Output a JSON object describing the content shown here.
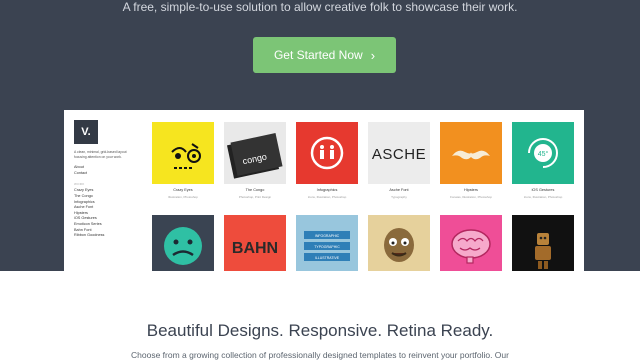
{
  "hero": {
    "tagline": "A free, simple-to-use solution to allow creative folk to showcase their work.",
    "cta_label": "Get Started Now",
    "cta_icon": "chevron-right-icon",
    "colors": {
      "background": "#3b4351",
      "cta": "#7cc576"
    }
  },
  "preview": {
    "logo": "V.",
    "description": "A clean, minimal, grid-based layout focusing attention on your work.",
    "links": [
      "About",
      "Contact"
    ],
    "work_heading": "WORK",
    "work_items": [
      "Crazy Eyes",
      "The Congo",
      "Infographics",
      "Asche Font",
      "Hipsters",
      "iOS Gestures",
      "Emoticon Series",
      "Bahn Font",
      "Ribbon Goodness"
    ],
    "tiles": [
      {
        "title": "Crazy Eyes",
        "tags": "Illustration, Photoshop",
        "bg": "#f6e51f"
      },
      {
        "title": "The Congo",
        "tags": "Photoshop, Print Design",
        "bg": "#e9e9e9"
      },
      {
        "title": "Infographics",
        "tags": "Icons, Illustration, Photoshop",
        "bg": "#e6392f"
      },
      {
        "title": "Asche Font",
        "tags": "Typography",
        "bg": "#ececec"
      },
      {
        "title": "Hipsters",
        "tags": "Fonwas, Illustration, Photoshop",
        "bg": "#f2901f"
      },
      {
        "title": "iOS Gestures",
        "tags": "Icons, Illustration, Photoshop",
        "bg": "#22b58e"
      },
      {
        "title": "",
        "tags": "",
        "bg": "#3a4452"
      },
      {
        "title": "",
        "tags": "",
        "bg": "#ee4c3c"
      },
      {
        "title": "",
        "tags": "",
        "bg": "#98c6dd"
      },
      {
        "title": "",
        "tags": "",
        "bg": "#e6d19c"
      },
      {
        "title": "",
        "tags": "",
        "bg": "#ef4e97"
      },
      {
        "title": "",
        "tags": "",
        "bg": "#111111"
      }
    ],
    "tile_art": {
      "congo_word": "congo",
      "asche_word": "ASCHE",
      "bahn_word": "BAHN",
      "gesture_badge": "45°",
      "ribbons": [
        "INFOGRAPHIC",
        "TYPOGRAPHIC",
        "ILLUSTRATIVE"
      ]
    }
  },
  "lower": {
    "title": "Beautiful Designs. Responsive. Retina Ready.",
    "text": "Choose from a growing collection of professionally designed templates to reinvent your portfolio. Our"
  }
}
